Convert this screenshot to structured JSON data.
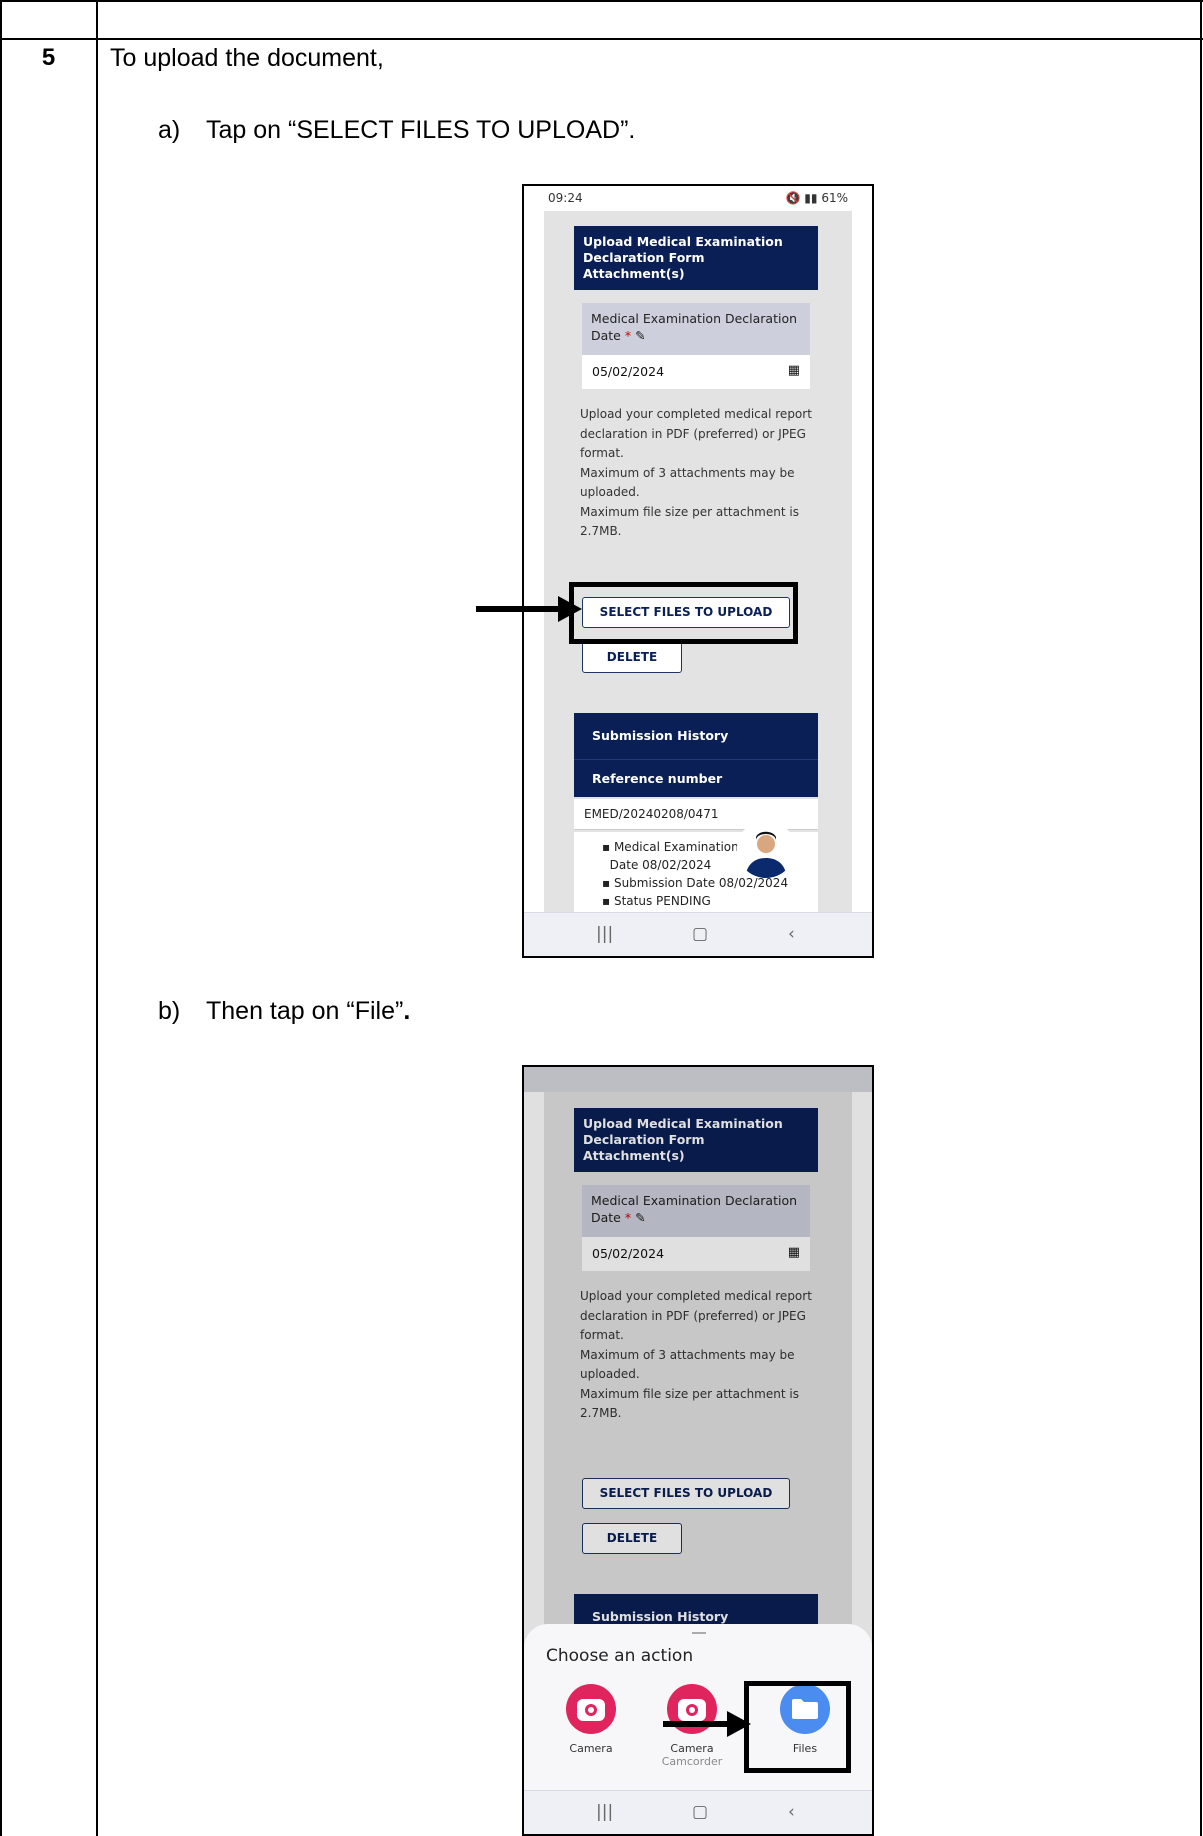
{
  "step": {
    "number": "5",
    "intro": "To upload the document,",
    "sub_a": {
      "label": "a)",
      "text": "Tap on “SELECT FILES TO UPLOAD”."
    },
    "sub_b": {
      "label": "b)",
      "text_main": "Then tap on “File”",
      "text_bold": "."
    }
  },
  "phone": {
    "time": "09:24",
    "status_right": "61%",
    "card_title_line1": "Upload Medical Examination",
    "card_title_line2": "Declaration Form Attachment(s)",
    "date_label_line1": "Medical Examination Declaration",
    "date_label_line2": "Date",
    "required_mark": "*",
    "date_value": "05/02/2024",
    "info_lines": [
      "Upload your completed medical report",
      "declaration in PDF (preferred) or JPEG",
      "format.",
      "Maximum of 3 attachments may be",
      "uploaded.",
      "Maximum file size per attachment is",
      "2.7MB."
    ],
    "select_button": "SELECT FILES TO UPLOAD",
    "delete_button": "DELETE",
    "history_title": "Submission History",
    "reference_header": "Reference number",
    "reference_value": "EMED/20240208/0471",
    "history_items": [
      "Medical Examination I",
      "Date 08/02/2024",
      "Submission Date 08/02/2024",
      "Status PENDING"
    ],
    "nav": {
      "recents": "|||",
      "home": "▢",
      "back": "‹"
    }
  },
  "sheet": {
    "title": "Choose an action",
    "apps": [
      {
        "name": "Camera",
        "sub": ""
      },
      {
        "name": "Camera",
        "sub": "Camcorder"
      },
      {
        "name": "Files",
        "sub": ""
      }
    ]
  },
  "colors": {
    "navy": "#0a1f55",
    "camera": "#e0245e",
    "files": "#4a8cf0"
  }
}
